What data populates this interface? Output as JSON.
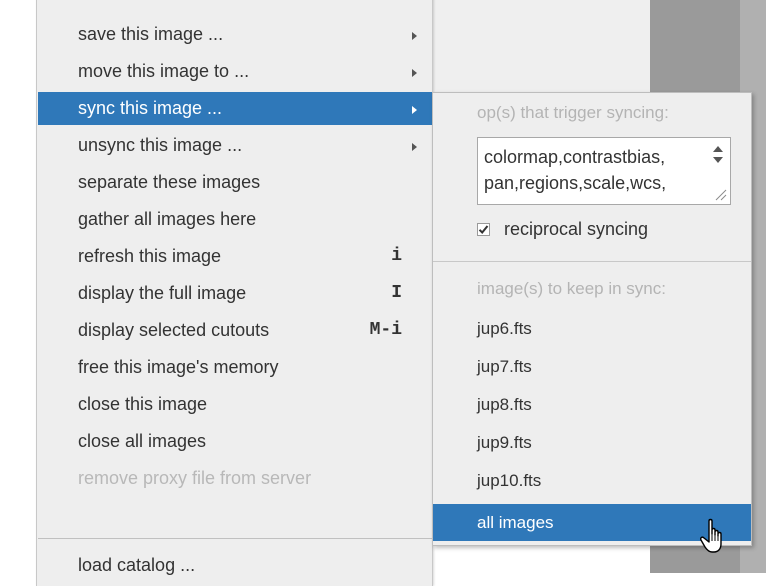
{
  "menu": {
    "items": [
      {
        "label": "save this image ...",
        "submenu": true,
        "state": "normal"
      },
      {
        "label": "move this image to ...",
        "submenu": true,
        "state": "normal"
      },
      {
        "label": "sync this image ...",
        "submenu": true,
        "state": "selected"
      },
      {
        "label": "unsync this image ...",
        "submenu": true,
        "state": "normal"
      },
      {
        "label": "separate these images",
        "state": "normal"
      },
      {
        "label": "gather all images here",
        "state": "normal"
      },
      {
        "label": "refresh this image",
        "shortcut": "i",
        "state": "normal"
      },
      {
        "label": "display the full image",
        "shortcut": "I",
        "state": "normal"
      },
      {
        "label": "display selected cutouts",
        "shortcut": "M-i",
        "state": "normal"
      },
      {
        "label": "free this image's memory",
        "state": "normal"
      },
      {
        "label": "close this image",
        "state": "normal"
      },
      {
        "label": "close all images",
        "state": "normal"
      },
      {
        "label": "remove proxy file from server",
        "state": "disabled"
      },
      {
        "label": "load catalog ...",
        "state": "normal"
      }
    ],
    "selected_color": "#2f78b9",
    "disabled_color": "#b8b8b8"
  },
  "submenu": {
    "ops_header": "op(s) that trigger syncing:",
    "ops_lines": [
      "colormap,contrastbias,",
      "pan,regions,scale,wcs,"
    ],
    "reciprocal": {
      "label": "reciprocal syncing",
      "checked": true
    },
    "images_header": "image(s) to keep in sync:",
    "images": [
      "jup6.fts",
      "jup7.fts",
      "jup8.fts",
      "jup9.fts",
      "jup10.fts"
    ],
    "all_images_label": "all images"
  },
  "icons": {
    "submenu_arrow": "chevron-right-icon",
    "spinner": "spinner-arrows-icon",
    "resize": "resize-grip-icon",
    "checkbox": "checkbox-checked-icon",
    "cursor": "hand-pointer-icon"
  }
}
